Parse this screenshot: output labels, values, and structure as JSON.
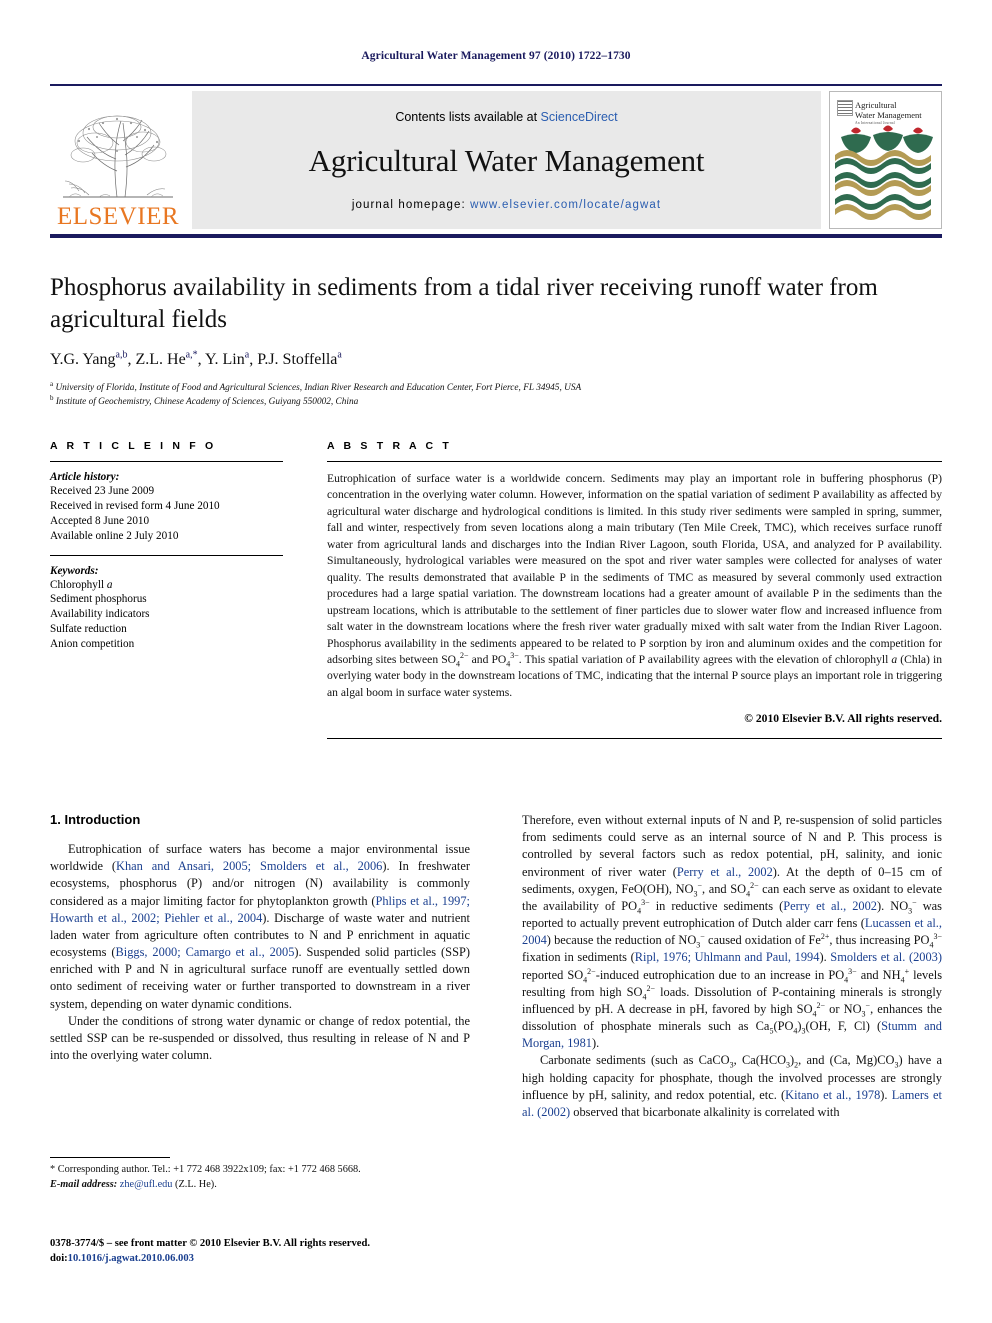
{
  "running_head": "Agricultural Water Management 97 (2010) 1722–1730",
  "masthead": {
    "publisher": "ELSEVIER",
    "contents_prefix": "Contents lists available at ",
    "contents_link": "ScienceDirect",
    "journal_name": "Agricultural Water Management",
    "homepage_prefix": "journal homepage: ",
    "homepage_url": "www.elsevier.com/locate/agwat",
    "cover_title_line1": "Agricultural",
    "cover_title_line2": "Water Management",
    "cover_subtitle": "An International Journal"
  },
  "article": {
    "title": "Phosphorus availability in sediments from a tidal river receiving runoff water from agricultural fields",
    "authors_html": "Y.G. Yang<sup>a,b</sup>, Z.L. He<sup>a,*</sup>, Y. Lin<sup>a</sup>, P.J. Stoffella<sup>a</sup>",
    "affiliation_a": "University of Florida, Institute of Food and Agricultural Sciences, Indian River Research and Education Center, Fort Pierce, FL 34945, USA",
    "affiliation_b": "Institute of Geochemistry, Chinese Academy of Sciences, Guiyang 550002, China"
  },
  "article_info": {
    "heading": "A R T I C L E  I N F O",
    "history_label": "Article history:",
    "history": [
      "Received 23 June 2009",
      "Received in revised form 4 June 2010",
      "Accepted 8 June 2010",
      "Available online 2 July 2010"
    ],
    "keywords_label": "Keywords:",
    "keywords": [
      "Chlorophyll a",
      "Sediment phosphorus",
      "Availability indicators",
      "Sulfate reduction",
      "Anion competition"
    ]
  },
  "abstract": {
    "heading": "A B S T R A C T",
    "body_html": "Eutrophication of surface water is a worldwide concern. Sediments may play an important role in buffering phosphorus (P) concentration in the overlying water column. However, information on the spatial variation of sediment P availability as affected by agricultural water discharge and hydrological conditions is limited. In this study river sediments were sampled in spring, summer, fall and winter, respectively from seven locations along a main tributary (Ten Mile Creek, TMC), which receives surface runoff water from agricultural lands and discharges into the Indian River Lagoon, south Florida, USA, and analyzed for P availability. Simultaneously, hydrological variables were measured on the spot and river water samples were collected for analyses of water quality. The results demonstrated that available P in the sediments of TMC as measured by several commonly used extraction procedures had a large spatial variation. The downstream locations had a greater amount of available P in the sediments than the upstream locations, which is attributable to the settlement of finer particles due to slower water flow and increased influence from salt water in the downstream locations where the fresh river water gradually mixed with salt water from the Indian River Lagoon. Phosphorus availability in the sediments appeared to be related to P sorption by iron and aluminum oxides and the competition for adsorbing sites between SO<sub>4</sub><sup>2&minus;</sup> and PO<sub>4</sub><sup>3&minus;</sup>. This spatial variation of P availability agrees with the elevation of chlorophyll <i>a</i> (Chla) in overlying water body in the downstream locations of TMC, indicating that the internal P source plays an important role in triggering an algal boom in surface water systems.",
    "copyright": "© 2010 Elsevier B.V. All rights reserved."
  },
  "introduction": {
    "heading": "1. Introduction",
    "left_paragraphs_html": [
      "Eutrophication of surface waters has become a major environmental issue worldwide (<span class=\"cite\">Khan and Ansari, 2005; Smolders et al., 2006</span>). In freshwater ecosystems, phosphorus (P) and/or nitrogen (N) availability is commonly considered as a major limiting factor for phytoplankton growth (<span class=\"cite\">Phlips et al., 1997; Howarth et al., 2002; Piehler et al., 2004</span>). Discharge of waste water and nutrient laden water from agriculture often contributes to N and P enrichment in aquatic ecosystems (<span class=\"cite\">Biggs, 2000; Camargo et al., 2005</span>). Suspended solid particles (SSP) enriched with P and N in agricultural surface runoff are eventually settled down onto sediment of receiving water or further transported to downstream in a river system, depending on water dynamic conditions.",
      "Under the conditions of strong water dynamic or change of redox potential, the settled SSP can be re-suspended or dissolved, thus resulting in release of N and P into the overlying water column."
    ],
    "right_paragraphs_html": [
      "Therefore, even without external inputs of N and P, re-suspension of solid particles from sediments could serve as an internal source of N and P. This process is controlled by several factors such as redox potential, pH, salinity, and ionic environment of river water (<span class=\"cite\">Perry et al., 2002</span>). At the depth of 0&ndash;15 cm of sediments, oxygen, FeO(OH), NO<sub>3</sub><sup>&minus;</sup>, and SO<sub>4</sub><sup>2&minus;</sup> can each serve as oxidant to elevate the availability of PO<sub>4</sub><sup>3&minus;</sup> in reductive sediments (<span class=\"cite\">Perry et al., 2002</span>). NO<sub>3</sub><sup>&minus;</sup> was reported to actually prevent eutrophication of Dutch alder carr fens (<span class=\"cite\">Lucassen et al., 2004</span>) because the reduction of NO<sub>3</sub><sup>&minus;</sup> caused oxidation of Fe<sup>2+</sup>, thus increasing PO<sub>4</sub><sup>3&minus;</sup> fixation in sediments (<span class=\"cite\">Ripl, 1976; Uhlmann and Paul, 1994</span>). <span class=\"cite\">Smolders et al. (2003)</span> reported SO<sub>4</sub><sup>2&minus;</sup>-induced eutrophication due to an increase in PO<sub>4</sub><sup>3&minus;</sup> and NH<sub>4</sub><sup>+</sup> levels resulting from high SO<sub>4</sub><sup>2&minus;</sup> loads. Dissolution of P-containing minerals is strongly influenced by pH. A decrease in pH, favored by high SO<sub>4</sub><sup>2&minus;</sup> or NO<sub>3</sub><sup>&minus;</sup>, enhances the dissolution of phosphate minerals such as Ca<sub>5</sub>(PO<sub>4</sub>)<sub>3</sub>(OH, F, Cl) (<span class=\"cite\">Stumm and Morgan, 1981</span>).",
      "Carbonate sediments (such as CaCO<sub>3</sub>, Ca(HCO<sub>3</sub>)<sub>2</sub>, and (Ca, Mg)CO<sub>3</sub>) have a high holding capacity for phosphate, though the involved processes are strongly influence by pH, salinity, and redox potential, etc. (<span class=\"cite\">Kitano et al., 1978</span>). <span class=\"cite\">Lamers et al. (2002)</span> observed that bicarbonate alkalinity is correlated with"
    ]
  },
  "footnotes": {
    "corresponding": "* Corresponding author. Tel.: +1 772 468 3922x109; fax: +1 772 468 5668.",
    "email_label": "E-mail address:",
    "email": "zhe@ufl.edu",
    "email_suffix": "(Z.L. He).",
    "imprint": "0378-3774/$ – see front matter © 2010 Elsevier B.V. All rights reserved.",
    "doi_label": "doi:",
    "doi": "10.1016/j.agwat.2010.06.003"
  },
  "colors": {
    "navy": "#1a1a5e",
    "elsevier_orange": "#E87722",
    "link_blue": "#2a5db0",
    "cite_blue": "#1a3f8f",
    "band_grey": "#e9e9e9"
  }
}
